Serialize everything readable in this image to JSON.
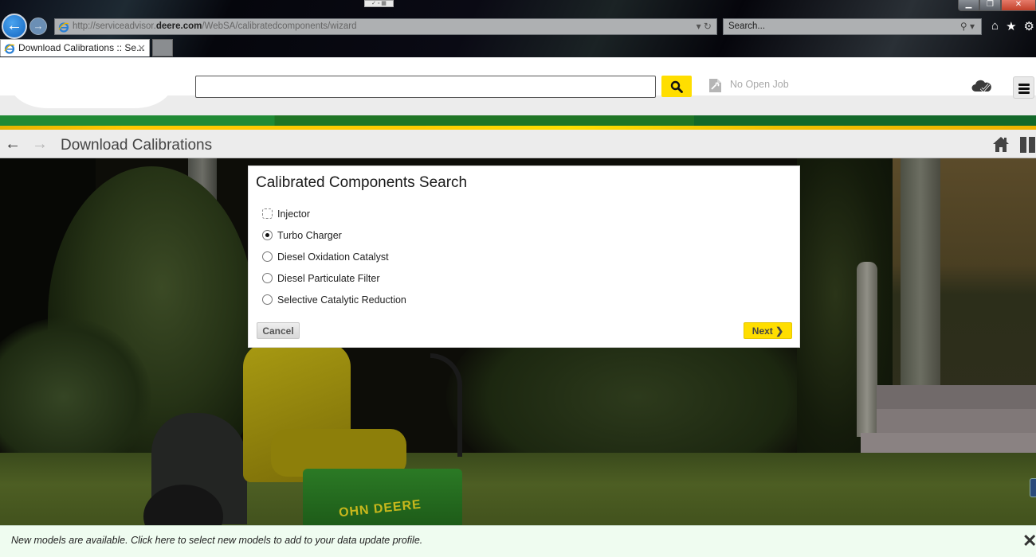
{
  "browser": {
    "url_prefix": "http://serviceadvisor.",
    "url_domain": "deere.com",
    "url_path": "/WebSA/calibratedcomponents/wizard",
    "url_tools": "▾ ↻",
    "search_placeholder": "Search...",
    "search_icon": "⚲ ▾",
    "tab_title": "Download Calibrations :: Se...",
    "tab_close": "✕",
    "back_glyph": "←",
    "forward_glyph": "→",
    "window_controls": {
      "minimize": "▁",
      "restore": "❐",
      "close": "✕"
    },
    "toolbar_icons": {
      "home": "⌂",
      "favorites": "★",
      "settings": "⚙"
    }
  },
  "app_header": {
    "search_value": "",
    "job_status": "No Open Job"
  },
  "colors": {
    "accent_yellow": "#ffde00",
    "brand_green": "#1f7525",
    "notification_bg": "#effcf0"
  },
  "breadcrumb": {
    "back_glyph": "🡐",
    "forward_glyph": "🡒",
    "title": "Download Calibrations"
  },
  "dialog": {
    "title": "Calibrated Components Search",
    "options": [
      {
        "label": "Injector",
        "checked": false,
        "focused": true
      },
      {
        "label": "Turbo Charger",
        "checked": true,
        "focused": false
      },
      {
        "label": "Diesel Oxidation Catalyst",
        "checked": false,
        "focused": false
      },
      {
        "label": "Diesel Particulate Filter",
        "checked": false,
        "focused": false
      },
      {
        "label": "Selective Catalytic Reduction",
        "checked": false,
        "focused": false
      }
    ],
    "cancel_label": "Cancel",
    "next_label": "Next ❯"
  },
  "background": {
    "brand_text": "OHN DEERE"
  },
  "notification": {
    "message": "New models are available. Click here to select new models to add to your data update profile.",
    "close_glyph": "✕"
  }
}
